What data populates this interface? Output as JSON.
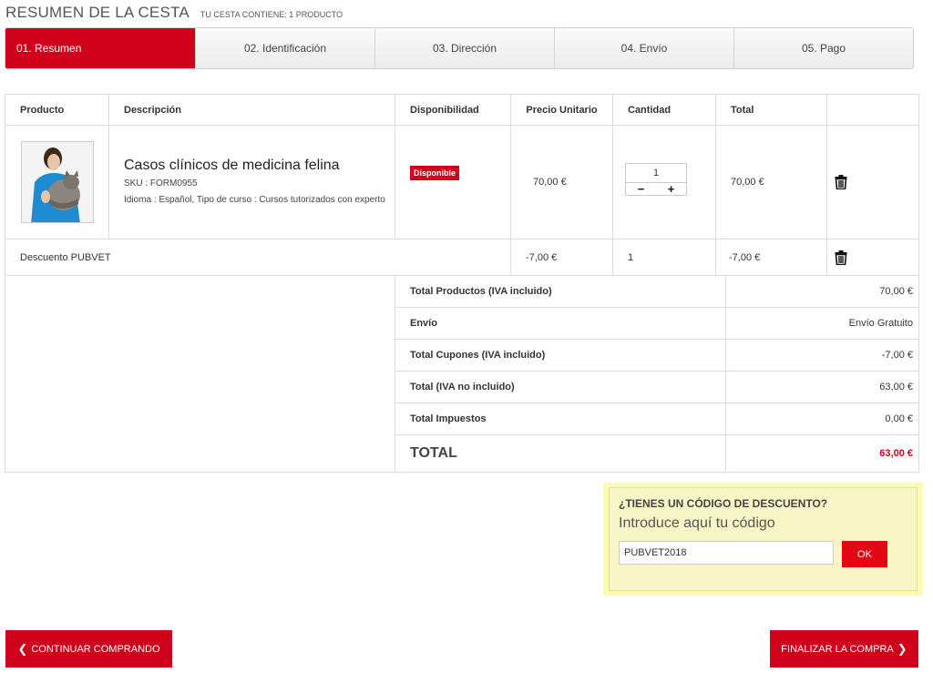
{
  "header": {
    "title": "RESUMEN DE LA CESTA",
    "subtitle": "TU CESTA CONTIENE: 1 PRODUCTO"
  },
  "steps": [
    {
      "label": "01. Resumen",
      "active": true
    },
    {
      "label": "02. Identificación",
      "active": false
    },
    {
      "label": "03. Dirección",
      "active": false
    },
    {
      "label": "04. Envío",
      "active": false
    },
    {
      "label": "05. Pago",
      "active": false
    }
  ],
  "cart": {
    "columns": [
      "Producto",
      "Descripción",
      "Disponibilidad",
      "Precio Unitario",
      "Cantidad",
      "Total",
      ""
    ],
    "product": {
      "name": "Casos clínicos de medicina felina",
      "sku": "SKU : FORM0955",
      "attributes": "Idioma : Español, Tipo de curso : Cursos tutorizados con experto",
      "availability": "Disponible",
      "unit_price": "70,00 €",
      "quantity": "1",
      "total": "70,00 €",
      "minus": "−",
      "plus": "+"
    },
    "discount": {
      "label": "Descuento PUBVET",
      "unit_price": "-7,00 €",
      "quantity": "1",
      "total": "-7,00 €"
    }
  },
  "totals": [
    {
      "label": "Total Productos (IVA incluido)",
      "value": "70,00 €"
    },
    {
      "label": "Envío",
      "value": "Envío Gratuito"
    },
    {
      "label": "Total Cupones (IVA incluido)",
      "value": "-7,00 €"
    },
    {
      "label": "Total (IVA no incluido)",
      "value": "63,00 €"
    },
    {
      "label": "Total Impuestos",
      "value": "0,00 €"
    }
  ],
  "grand_total": {
    "label": "TOTAL",
    "value": "63,00 €"
  },
  "coupon": {
    "title": "¿TIENES UN CÓDIGO DE DESCUENTO?",
    "subtitle": "Introduce aquí tu código",
    "value": "PUBVET2018",
    "button": "OK"
  },
  "actions": {
    "continue": "CONTINUAR COMPRANDO",
    "finish": "FINALIZAR LA COMPRA"
  },
  "colors": {
    "accent": "#d0021b",
    "coupon_bg": "#fdfbb3"
  }
}
